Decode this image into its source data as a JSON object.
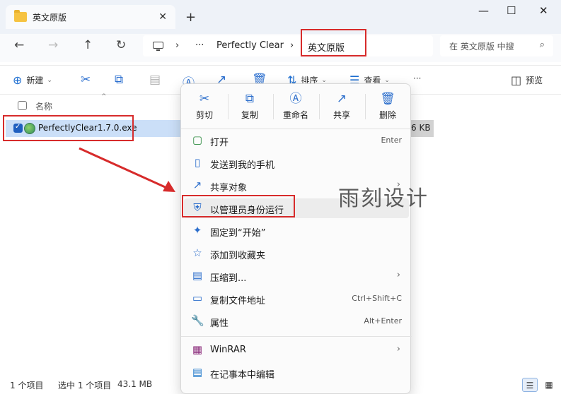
{
  "window": {
    "tab_title": "英文原版",
    "minimize": "—",
    "maximize": "☐",
    "close": "✕",
    "tab_close": "✕",
    "new_tab": "+"
  },
  "nav": {
    "back": "←",
    "forward": "→",
    "up": "↑",
    "refresh": "↻",
    "breadcrumb": {
      "more": "···",
      "sep": "›",
      "item1": "Perfectly Clear",
      "item2": "英文原版"
    },
    "search_placeholder": "在 英文原版 中搜",
    "search_icon": "⌕"
  },
  "toolbar": {
    "new_label": "新建",
    "sort_label": "排序",
    "view_label": "查看",
    "more": "···",
    "preview_label": "预览",
    "icons": [
      "new-icon",
      "cut-icon",
      "copy-icon",
      "paste-icon",
      "rename-icon",
      "share-icon",
      "delete-icon"
    ]
  },
  "list": {
    "col_name": "名称",
    "files": [
      {
        "name": "PerfectlyClear1.7.0.exe",
        "size": "6 KB",
        "checked": true
      }
    ]
  },
  "status": {
    "count": "1 个项目",
    "selected": "选中 1 个项目",
    "size": "43.1 MB"
  },
  "context_menu": {
    "quick_actions": [
      {
        "label": "剪切",
        "icon": "cut-icon",
        "glyph": "✂"
      },
      {
        "label": "复制",
        "icon": "copy-icon",
        "glyph": "⧉"
      },
      {
        "label": "重命名",
        "icon": "rename-icon",
        "glyph": "Ⓐ"
      },
      {
        "label": "共享",
        "icon": "share-icon",
        "glyph": "↗"
      },
      {
        "label": "删除",
        "icon": "delete-icon",
        "glyph": "🗑"
      }
    ],
    "items": [
      {
        "label": "打开",
        "shortcut": "Enter",
        "icon": "open-icon",
        "glyph": "▢"
      },
      {
        "label": "发送到我的手机",
        "icon": "phone-icon",
        "glyph": "▯"
      },
      {
        "label": "共享对象",
        "submenu": true,
        "icon": "share-object-icon",
        "glyph": "↗"
      },
      {
        "label": "以管理员身份运行",
        "icon": "admin-shield-icon",
        "glyph": "⛨"
      },
      {
        "label": "固定到“开始”",
        "icon": "pin-icon",
        "glyph": "✦"
      },
      {
        "label": "添加到收藏夹",
        "icon": "star-icon",
        "glyph": "☆"
      },
      {
        "label": "压缩到...",
        "submenu": true,
        "icon": "zip-icon",
        "glyph": "▤"
      },
      {
        "label": "复制文件地址",
        "shortcut": "Ctrl+Shift+C",
        "icon": "copy-path-icon",
        "glyph": "▭"
      },
      {
        "label": "属性",
        "shortcut": "Alt+Enter",
        "icon": "properties-icon",
        "glyph": "🔧"
      },
      {
        "label": "WinRAR",
        "submenu": true,
        "icon": "winrar-icon",
        "glyph": "▦"
      },
      {
        "label": "在记事本中编辑",
        "icon": "notepad-icon",
        "glyph": "▤"
      }
    ],
    "submenu_glyph": "›"
  },
  "watermark": "雨刻设计",
  "colors": {
    "annotation_red": "#d72b2b",
    "accent_blue": "#1f5fbf",
    "selection": "#cbdff8"
  }
}
